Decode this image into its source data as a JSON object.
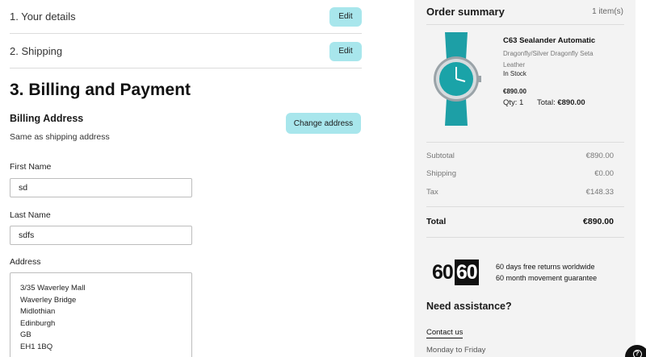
{
  "steps": {
    "details_label": "1. Your details",
    "shipping_label": "2. Shipping",
    "edit_label": "Edit",
    "billing_title": "3. Billing and Payment"
  },
  "billing": {
    "heading": "Billing Address",
    "subtext": "Same as shipping address",
    "change_label": "Change address",
    "first_name_label": "First Name",
    "first_name_value": "sd",
    "last_name_label": "Last Name",
    "last_name_value": "sdfs",
    "address_label": "Address",
    "address_lines": [
      "3/35 Waverley Mall",
      "Waverley Bridge",
      "Midlothian",
      "Edinburgh",
      "GB",
      "EH1 1BQ"
    ]
  },
  "summary": {
    "title": "Order summary",
    "count": "1 item(s)",
    "product": {
      "name": "C63 Sealander Automatic",
      "variant": "Dragonfly/Silver  Dragonfly Seta Leather",
      "stock": "In Stock",
      "price": "€890.00",
      "qty": "Qty: 1",
      "total_label": "Total:",
      "total_value": "€890.00"
    },
    "subtotal_label": "Subtotal",
    "subtotal_value": "€890.00",
    "shipping_label": "Shipping",
    "shipping_value": "€0.00",
    "tax_label": "Tax",
    "tax_value": "€148.33",
    "total_label": "Total",
    "total_value": "€890.00"
  },
  "promo": {
    "logo_a": "60",
    "logo_b": "60",
    "line1": "60 days free returns worldwide",
    "line2": "60 month movement guarantee"
  },
  "assist": {
    "heading": "Need assistance?",
    "contact": "Contact us",
    "hours": "Monday to Friday"
  },
  "help": {
    "icon": "question-icon",
    "glyph": "?"
  },
  "colors": {
    "accent_button": "#a8e6ec",
    "sidebar_bg": "#f3f3f3",
    "watch_dial": "#1aa3a8"
  }
}
